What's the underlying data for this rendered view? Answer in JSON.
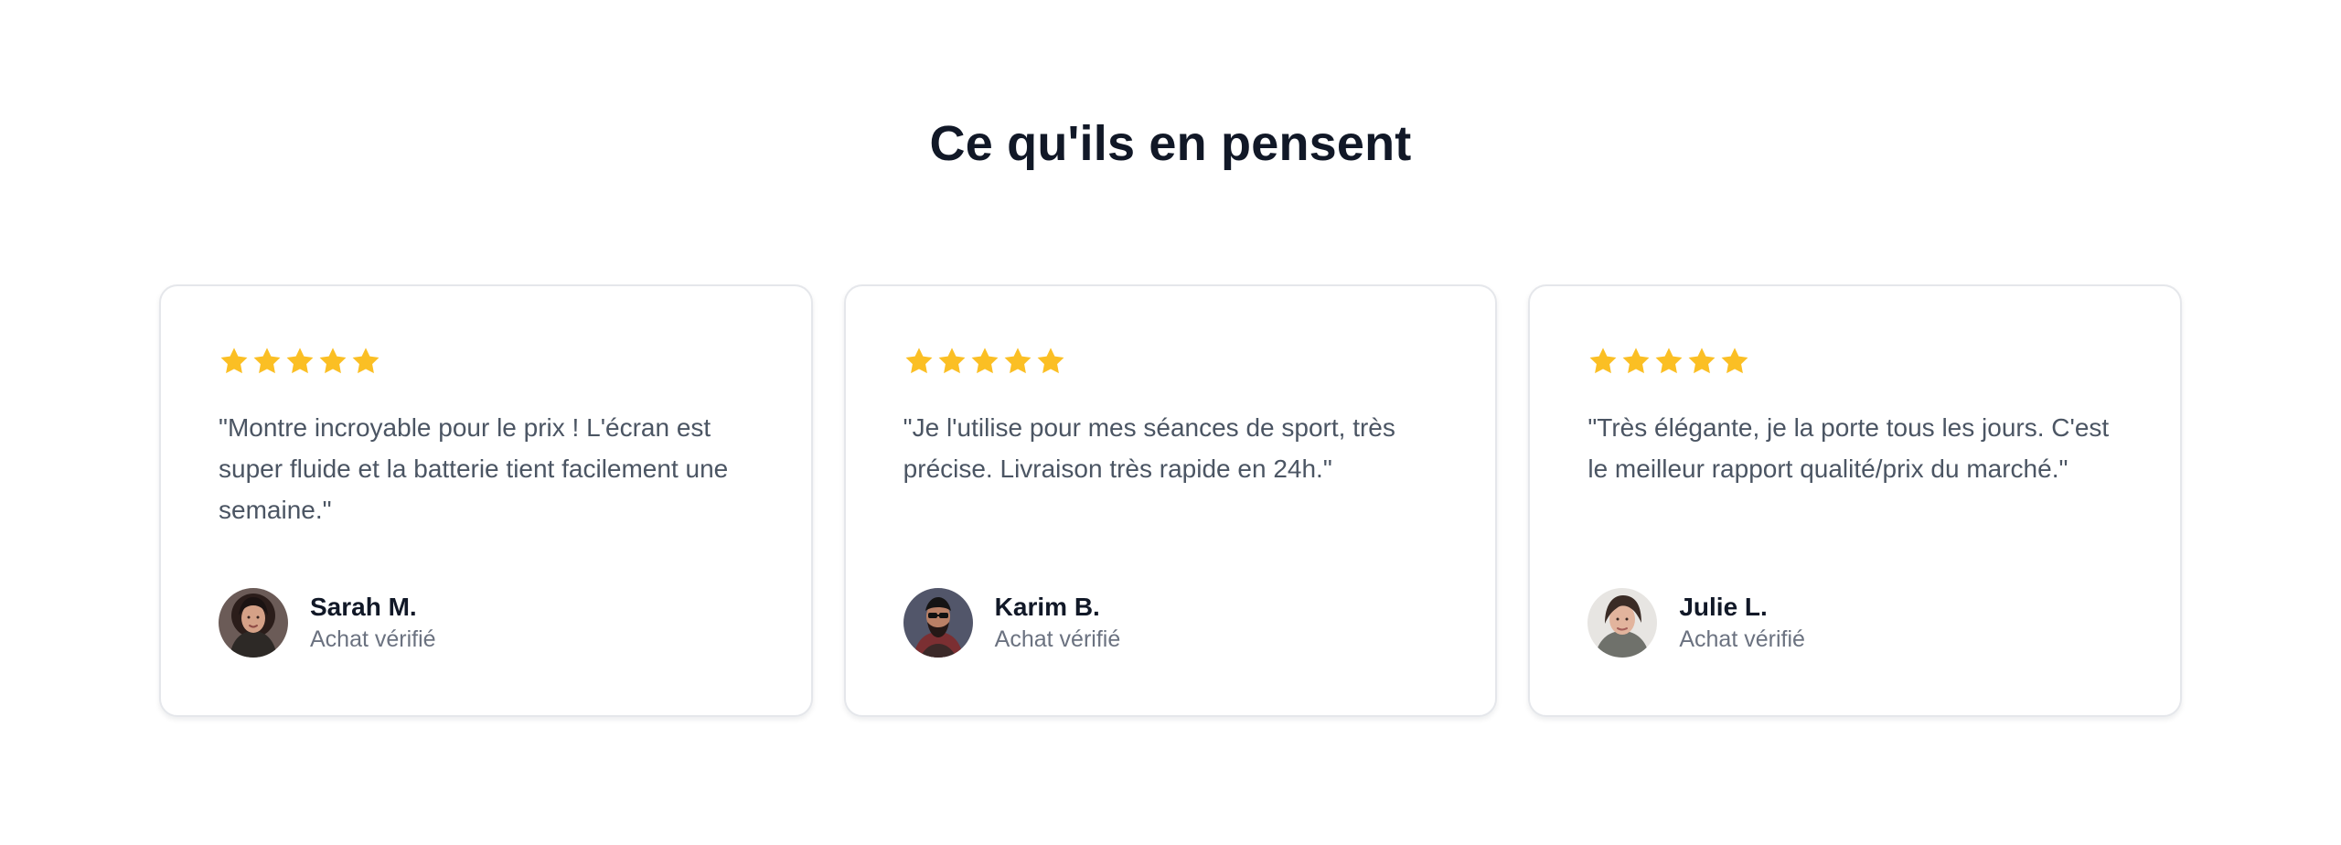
{
  "section": {
    "title": "Ce qu'ils en pensent"
  },
  "reviews": [
    {
      "rating": 5,
      "quote": "\"Montre incroyable pour le prix ! L'écran est super fluide et la batterie tient facilement une semaine.\"",
      "author_name": "Sarah M.",
      "author_meta": "Achat vérifié",
      "avatar_icon": "woman-portrait-avatar"
    },
    {
      "rating": 5,
      "quote": "\"Je l'utilise pour mes séances de sport, très précise. Livraison très rapide en 24h.\"",
      "author_name": "Karim B.",
      "author_meta": "Achat vérifié",
      "avatar_icon": "man-portrait-avatar"
    },
    {
      "rating": 5,
      "quote": "\"Très élégante, je la porte tous les jours. C'est le meilleur rapport qualité/prix du marché.\"",
      "author_name": "Julie L.",
      "author_meta": "Achat vérifié",
      "avatar_icon": "woman-portrait-avatar"
    }
  ],
  "colors": {
    "star": "#fbbf24",
    "heading": "#111827",
    "quote_text": "#4b5563",
    "meta_text": "#6b7280",
    "card_border": "#e5e7eb"
  }
}
